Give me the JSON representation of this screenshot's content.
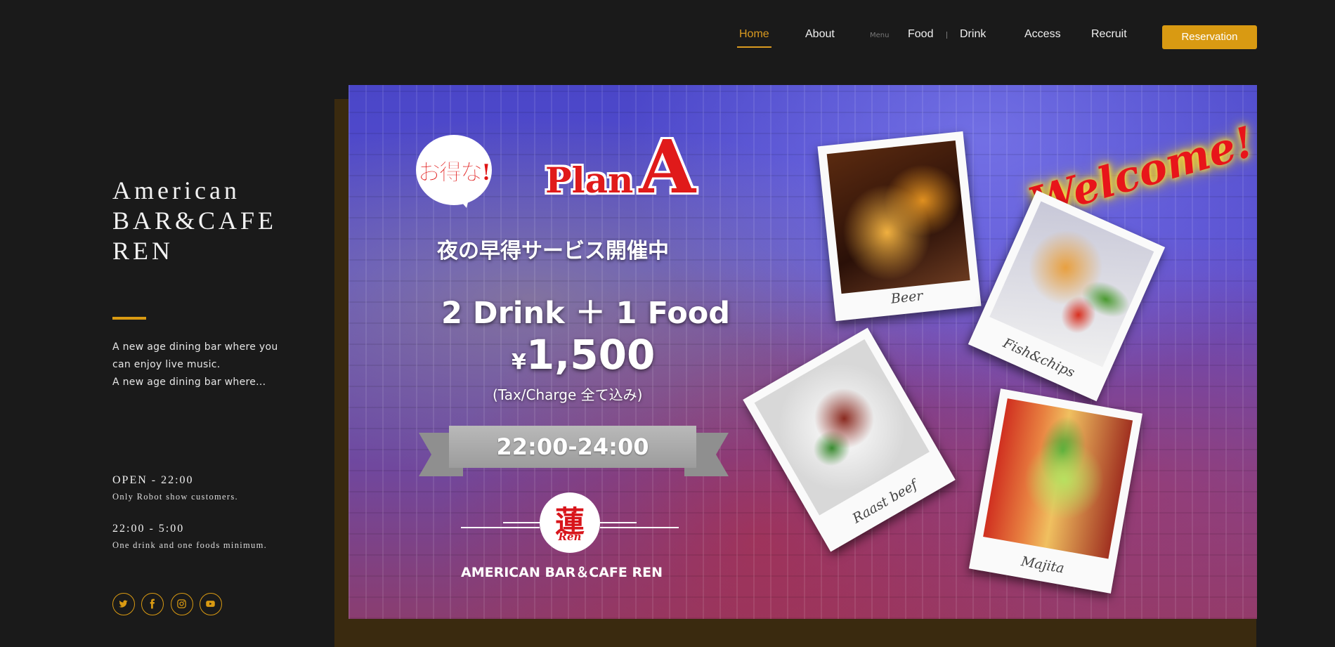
{
  "nav": {
    "items": [
      {
        "label": "Home",
        "active": true
      },
      {
        "label": "About"
      },
      {
        "label": "Food"
      },
      {
        "label": "Drink"
      },
      {
        "label": "Access"
      },
      {
        "label": "Recruit"
      }
    ],
    "menu_tag": "Menu",
    "reservation_label": "Reservation"
  },
  "brand": {
    "lines": [
      "American",
      "BAR&CAFE",
      "REN"
    ],
    "accent_color": "#d99a12"
  },
  "description": [
    "A new age dining bar where you",
    "can enjoy live music.",
    "A new age dining bar where..."
  ],
  "hours": [
    {
      "title": "OPEN - 22:00",
      "sub": "Only Robot show customers."
    },
    {
      "title": "22:00 - 5:00",
      "sub": "One drink and one foods minimum."
    }
  ],
  "social": [
    "twitter-icon",
    "facebook-icon",
    "instagram-icon",
    "youtube-icon"
  ],
  "hero": {
    "badge": "お得な!",
    "plan_word": "Plan",
    "plan_letter": "A",
    "subtitle": "夜の早得サービス開催中",
    "offer": "2 Drink ＋ 1 Food",
    "price_yen": "¥",
    "price": "1,500",
    "tax_note": "(Tax/Charge 全て込み)",
    "time_range": "22:00-24:00",
    "logo_kanji": "蓮",
    "logo_roman": "Ren",
    "logo_text": "AMERICAN BAR＆CAFE REN",
    "welcome": "Welcome!",
    "photos": [
      {
        "caption": "Beer"
      },
      {
        "caption": "Fish&chips"
      },
      {
        "caption": "Raast beef"
      },
      {
        "caption": "Majita"
      }
    ]
  }
}
